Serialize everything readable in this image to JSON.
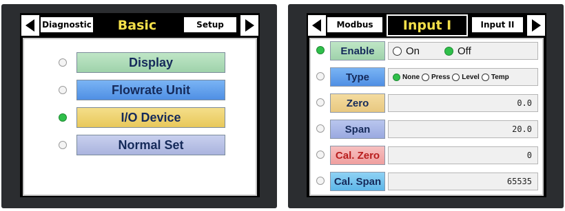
{
  "left_screen": {
    "tabs": {
      "prev": "Diagnostic",
      "title": "Basic",
      "next": "Setup"
    },
    "menu": [
      {
        "label": "Display",
        "selected": false
      },
      {
        "label": "Flowrate Unit",
        "selected": false
      },
      {
        "label": "I/O Device",
        "selected": true
      },
      {
        "label": "Normal Set",
        "selected": false
      }
    ]
  },
  "right_screen": {
    "tabs": {
      "prev": "Modbus",
      "title": "Input I",
      "next": "Input II"
    },
    "rows": {
      "enable": {
        "label": "Enable",
        "on_label": "On",
        "off_label": "Off",
        "selected": "Off"
      },
      "type": {
        "label": "Type",
        "options": [
          "None",
          "Press",
          "Level",
          "Temp"
        ],
        "selected": "None"
      },
      "zero": {
        "label": "Zero",
        "value": "0.0"
      },
      "span": {
        "label": "Span",
        "value": "20.0"
      },
      "cal_zero": {
        "label": "Cal. Zero",
        "value": "0"
      },
      "cal_span": {
        "label": "Cal. Span",
        "value": "65535"
      }
    },
    "selected_row": "enable"
  },
  "colors": {
    "title_yellow": "#f4e04a",
    "radio_on": "#2fbf4a",
    "bezel": "#2b2d30"
  }
}
